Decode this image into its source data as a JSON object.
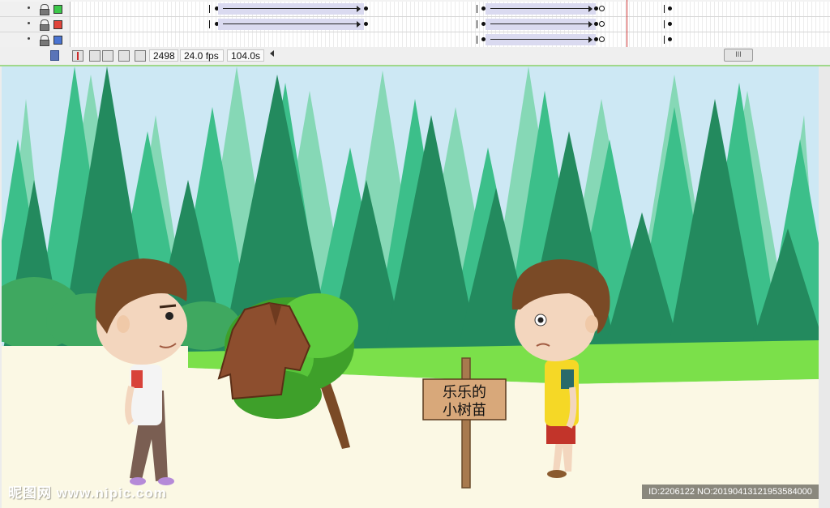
{
  "timeline": {
    "layers": [
      {
        "color": "#3cc84a"
      },
      {
        "color": "#e0443a"
      },
      {
        "color": "#4a74d2"
      }
    ]
  },
  "controls": {
    "current_frame": "2498",
    "frame_rate": "24.0 fps",
    "elapsed_time": "104.0s",
    "scroll_thumb": "III"
  },
  "scene": {
    "sign_line1": "乐乐的",
    "sign_line2": "小树苗",
    "watermark_left": "昵图网 www.nipic.com",
    "watermark_right": "ID:2206122 NO:20190413121953584000"
  }
}
